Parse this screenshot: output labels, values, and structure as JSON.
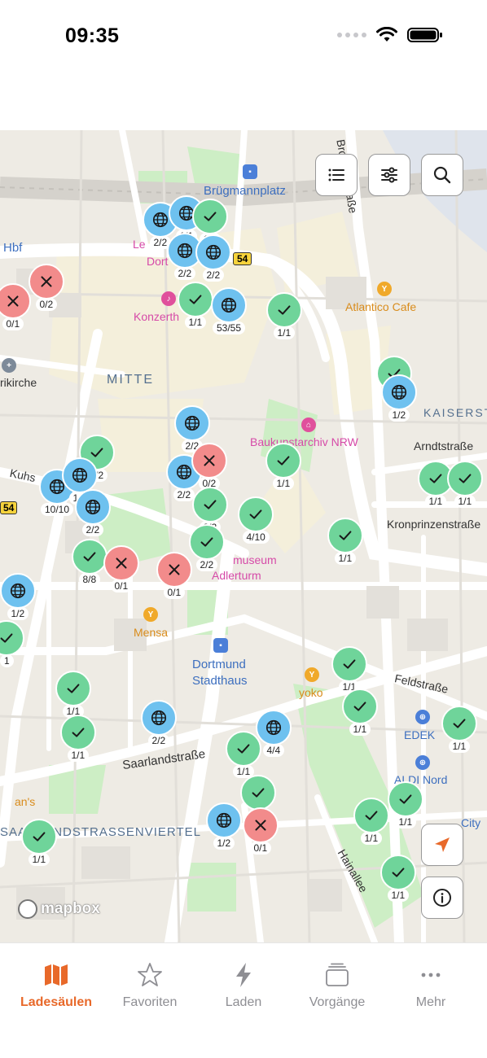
{
  "status": {
    "time": "09:35"
  },
  "map_labels": {
    "bruegmannplatz": "Brügmannplatz",
    "hbf": "Hbf",
    "le": "Le",
    "dort": "Dort",
    "konzerth": "Konzerth",
    "mitte": "MITTE",
    "kirche": "rikirche",
    "atlantico": "Atlantico Cafe",
    "kaiserst": "KAISERST",
    "baukunstarchiv": "Baukunstarchiv NRW",
    "arndtstrasse": "Arndtstraße",
    "kuhs": "Kuhs",
    "kronprinzenstrasse": "Kronprinzenstraße",
    "museum": "museum",
    "adlerturm": "Adlerturm",
    "mensa": "Mensa",
    "stadthaus_1": "Dortmund",
    "stadthaus_2": "Stadthaus",
    "yoko": "yoko",
    "feldstrasse": "Feldstraße",
    "edek": "EDEK",
    "saarlandstrasse": "Saarlandstraße",
    "aldi": "ALDI Nord",
    "ans": "an's",
    "viertel": "SAARLANDSTRASSENVIERTEL",
    "hainallee": "Hainallee",
    "city": "City",
    "rbahn": "54",
    "rbahn2": "54",
    "strasse_small": "Straße",
    "bronau": "Bronausstraße"
  },
  "markers": [
    {
      "type": "blue",
      "count": "2/2"
    },
    {
      "type": "blue",
      "count": "1/1"
    },
    {
      "type": "green",
      "count": "1/1"
    },
    {
      "type": "blue",
      "count": "2/2"
    },
    {
      "type": "blue",
      "count": "2/2"
    },
    {
      "type": "red",
      "count": "0/2"
    },
    {
      "type": "red",
      "count": "0/1"
    },
    {
      "type": "green",
      "count": "1/1"
    },
    {
      "type": "blue",
      "count": "53/55"
    },
    {
      "type": "green",
      "count": "1/1"
    },
    {
      "type": "green",
      "count": "1/1"
    },
    {
      "type": "blue",
      "count": "1/2"
    },
    {
      "type": "blue",
      "count": "2/2"
    },
    {
      "type": "green",
      "count": "1/2"
    },
    {
      "type": "blue",
      "count": "10/10"
    },
    {
      "type": "blue",
      "count": "1/2"
    },
    {
      "type": "blue",
      "count": "2/2"
    },
    {
      "type": "blue",
      "count": "2/2"
    },
    {
      "type": "red",
      "count": "0/2"
    },
    {
      "type": "green",
      "count": "2/2"
    },
    {
      "type": "green",
      "count": "1/1"
    },
    {
      "type": "green",
      "count": "4/10"
    },
    {
      "type": "green",
      "count": "2/2"
    },
    {
      "type": "green",
      "count": "8/8"
    },
    {
      "type": "red",
      "count": "0/1"
    },
    {
      "type": "red",
      "count": "0/1"
    },
    {
      "type": "green",
      "count": "1/1"
    },
    {
      "type": "green",
      "count": "1/1"
    },
    {
      "type": "green",
      "count": "1/1"
    },
    {
      "type": "blue",
      "count": "1/2"
    },
    {
      "type": "green",
      "count": "1"
    },
    {
      "type": "green",
      "count": "1/1"
    },
    {
      "type": "green",
      "count": "1/1"
    },
    {
      "type": "blue",
      "count": "2/2"
    },
    {
      "type": "green",
      "count": "1/1"
    },
    {
      "type": "green",
      "count": "1/1"
    },
    {
      "type": "blue",
      "count": "4/4"
    },
    {
      "type": "green",
      "count": "1/1"
    },
    {
      "type": "green",
      "count": "1/1"
    },
    {
      "type": "green",
      "count": "1/1"
    },
    {
      "type": "blue",
      "count": "1/2"
    },
    {
      "type": "red",
      "count": "0/1"
    },
    {
      "type": "green",
      "count": "1/1"
    },
    {
      "type": "green",
      "count": "1/1"
    },
    {
      "type": "green",
      "count": "1/1"
    },
    {
      "type": "green",
      "count": "1/1"
    }
  ],
  "map_controls": {
    "list": "list-icon",
    "filter": "filter-icon",
    "search": "search-icon",
    "locate": "location-arrow-icon",
    "info": "info-icon"
  },
  "attribution": "mapbox",
  "tabs": [
    {
      "label": "Ladesäulen",
      "icon": "map-icon",
      "active": true
    },
    {
      "label": "Favoriten",
      "icon": "star-icon",
      "active": false
    },
    {
      "label": "Laden",
      "icon": "bolt-icon",
      "active": false
    },
    {
      "label": "Vorgänge",
      "icon": "stack-icon",
      "active": false
    },
    {
      "label": "Mehr",
      "icon": "more-icon",
      "active": false
    }
  ],
  "colors": {
    "accent": "#e8692a",
    "marker_green": "#6fd49a",
    "marker_blue": "#6ec1ef",
    "marker_red": "#f28b8b"
  }
}
